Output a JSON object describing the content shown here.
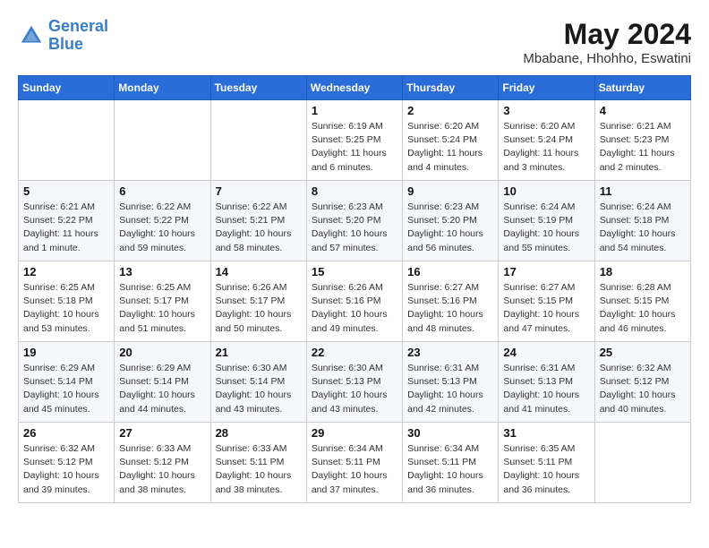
{
  "header": {
    "logo_line1": "General",
    "logo_line2": "Blue",
    "month_title": "May 2024",
    "location": "Mbabane, Hhohho, Eswatini"
  },
  "weekdays": [
    "Sunday",
    "Monday",
    "Tuesday",
    "Wednesday",
    "Thursday",
    "Friday",
    "Saturday"
  ],
  "weeks": [
    [
      {
        "day": "",
        "info": ""
      },
      {
        "day": "",
        "info": ""
      },
      {
        "day": "",
        "info": ""
      },
      {
        "day": "1",
        "info": "Sunrise: 6:19 AM\nSunset: 5:25 PM\nDaylight: 11 hours\nand 6 minutes."
      },
      {
        "day": "2",
        "info": "Sunrise: 6:20 AM\nSunset: 5:24 PM\nDaylight: 11 hours\nand 4 minutes."
      },
      {
        "day": "3",
        "info": "Sunrise: 6:20 AM\nSunset: 5:24 PM\nDaylight: 11 hours\nand 3 minutes."
      },
      {
        "day": "4",
        "info": "Sunrise: 6:21 AM\nSunset: 5:23 PM\nDaylight: 11 hours\nand 2 minutes."
      }
    ],
    [
      {
        "day": "5",
        "info": "Sunrise: 6:21 AM\nSunset: 5:22 PM\nDaylight: 11 hours\nand 1 minute."
      },
      {
        "day": "6",
        "info": "Sunrise: 6:22 AM\nSunset: 5:22 PM\nDaylight: 10 hours\nand 59 minutes."
      },
      {
        "day": "7",
        "info": "Sunrise: 6:22 AM\nSunset: 5:21 PM\nDaylight: 10 hours\nand 58 minutes."
      },
      {
        "day": "8",
        "info": "Sunrise: 6:23 AM\nSunset: 5:20 PM\nDaylight: 10 hours\nand 57 minutes."
      },
      {
        "day": "9",
        "info": "Sunrise: 6:23 AM\nSunset: 5:20 PM\nDaylight: 10 hours\nand 56 minutes."
      },
      {
        "day": "10",
        "info": "Sunrise: 6:24 AM\nSunset: 5:19 PM\nDaylight: 10 hours\nand 55 minutes."
      },
      {
        "day": "11",
        "info": "Sunrise: 6:24 AM\nSunset: 5:18 PM\nDaylight: 10 hours\nand 54 minutes."
      }
    ],
    [
      {
        "day": "12",
        "info": "Sunrise: 6:25 AM\nSunset: 5:18 PM\nDaylight: 10 hours\nand 53 minutes."
      },
      {
        "day": "13",
        "info": "Sunrise: 6:25 AM\nSunset: 5:17 PM\nDaylight: 10 hours\nand 51 minutes."
      },
      {
        "day": "14",
        "info": "Sunrise: 6:26 AM\nSunset: 5:17 PM\nDaylight: 10 hours\nand 50 minutes."
      },
      {
        "day": "15",
        "info": "Sunrise: 6:26 AM\nSunset: 5:16 PM\nDaylight: 10 hours\nand 49 minutes."
      },
      {
        "day": "16",
        "info": "Sunrise: 6:27 AM\nSunset: 5:16 PM\nDaylight: 10 hours\nand 48 minutes."
      },
      {
        "day": "17",
        "info": "Sunrise: 6:27 AM\nSunset: 5:15 PM\nDaylight: 10 hours\nand 47 minutes."
      },
      {
        "day": "18",
        "info": "Sunrise: 6:28 AM\nSunset: 5:15 PM\nDaylight: 10 hours\nand 46 minutes."
      }
    ],
    [
      {
        "day": "19",
        "info": "Sunrise: 6:29 AM\nSunset: 5:14 PM\nDaylight: 10 hours\nand 45 minutes."
      },
      {
        "day": "20",
        "info": "Sunrise: 6:29 AM\nSunset: 5:14 PM\nDaylight: 10 hours\nand 44 minutes."
      },
      {
        "day": "21",
        "info": "Sunrise: 6:30 AM\nSunset: 5:14 PM\nDaylight: 10 hours\nand 43 minutes."
      },
      {
        "day": "22",
        "info": "Sunrise: 6:30 AM\nSunset: 5:13 PM\nDaylight: 10 hours\nand 43 minutes."
      },
      {
        "day": "23",
        "info": "Sunrise: 6:31 AM\nSunset: 5:13 PM\nDaylight: 10 hours\nand 42 minutes."
      },
      {
        "day": "24",
        "info": "Sunrise: 6:31 AM\nSunset: 5:13 PM\nDaylight: 10 hours\nand 41 minutes."
      },
      {
        "day": "25",
        "info": "Sunrise: 6:32 AM\nSunset: 5:12 PM\nDaylight: 10 hours\nand 40 minutes."
      }
    ],
    [
      {
        "day": "26",
        "info": "Sunrise: 6:32 AM\nSunset: 5:12 PM\nDaylight: 10 hours\nand 39 minutes."
      },
      {
        "day": "27",
        "info": "Sunrise: 6:33 AM\nSunset: 5:12 PM\nDaylight: 10 hours\nand 38 minutes."
      },
      {
        "day": "28",
        "info": "Sunrise: 6:33 AM\nSunset: 5:11 PM\nDaylight: 10 hours\nand 38 minutes."
      },
      {
        "day": "29",
        "info": "Sunrise: 6:34 AM\nSunset: 5:11 PM\nDaylight: 10 hours\nand 37 minutes."
      },
      {
        "day": "30",
        "info": "Sunrise: 6:34 AM\nSunset: 5:11 PM\nDaylight: 10 hours\nand 36 minutes."
      },
      {
        "day": "31",
        "info": "Sunrise: 6:35 AM\nSunset: 5:11 PM\nDaylight: 10 hours\nand 36 minutes."
      },
      {
        "day": "",
        "info": ""
      }
    ]
  ]
}
